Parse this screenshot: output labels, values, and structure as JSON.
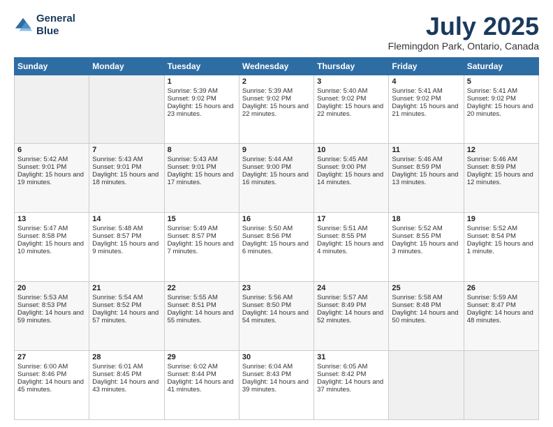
{
  "header": {
    "logo_line1": "General",
    "logo_line2": "Blue",
    "title": "July 2025",
    "subtitle": "Flemingdon Park, Ontario, Canada"
  },
  "weekdays": [
    "Sunday",
    "Monday",
    "Tuesday",
    "Wednesday",
    "Thursday",
    "Friday",
    "Saturday"
  ],
  "weeks": [
    [
      {
        "day": "",
        "empty": true
      },
      {
        "day": "",
        "empty": true
      },
      {
        "day": "1",
        "sunrise": "5:39 AM",
        "sunset": "9:02 PM",
        "daylight": "15 hours and 23 minutes."
      },
      {
        "day": "2",
        "sunrise": "5:39 AM",
        "sunset": "9:02 PM",
        "daylight": "15 hours and 22 minutes."
      },
      {
        "day": "3",
        "sunrise": "5:40 AM",
        "sunset": "9:02 PM",
        "daylight": "15 hours and 22 minutes."
      },
      {
        "day": "4",
        "sunrise": "5:41 AM",
        "sunset": "9:02 PM",
        "daylight": "15 hours and 21 minutes."
      },
      {
        "day": "5",
        "sunrise": "5:41 AM",
        "sunset": "9:02 PM",
        "daylight": "15 hours and 20 minutes."
      }
    ],
    [
      {
        "day": "6",
        "sunrise": "5:42 AM",
        "sunset": "9:01 PM",
        "daylight": "15 hours and 19 minutes."
      },
      {
        "day": "7",
        "sunrise": "5:43 AM",
        "sunset": "9:01 PM",
        "daylight": "15 hours and 18 minutes."
      },
      {
        "day": "8",
        "sunrise": "5:43 AM",
        "sunset": "9:01 PM",
        "daylight": "15 hours and 17 minutes."
      },
      {
        "day": "9",
        "sunrise": "5:44 AM",
        "sunset": "9:00 PM",
        "daylight": "15 hours and 16 minutes."
      },
      {
        "day": "10",
        "sunrise": "5:45 AM",
        "sunset": "9:00 PM",
        "daylight": "15 hours and 14 minutes."
      },
      {
        "day": "11",
        "sunrise": "5:46 AM",
        "sunset": "8:59 PM",
        "daylight": "15 hours and 13 minutes."
      },
      {
        "day": "12",
        "sunrise": "5:46 AM",
        "sunset": "8:59 PM",
        "daylight": "15 hours and 12 minutes."
      }
    ],
    [
      {
        "day": "13",
        "sunrise": "5:47 AM",
        "sunset": "8:58 PM",
        "daylight": "15 hours and 10 minutes."
      },
      {
        "day": "14",
        "sunrise": "5:48 AM",
        "sunset": "8:57 PM",
        "daylight": "15 hours and 9 minutes."
      },
      {
        "day": "15",
        "sunrise": "5:49 AM",
        "sunset": "8:57 PM",
        "daylight": "15 hours and 7 minutes."
      },
      {
        "day": "16",
        "sunrise": "5:50 AM",
        "sunset": "8:56 PM",
        "daylight": "15 hours and 6 minutes."
      },
      {
        "day": "17",
        "sunrise": "5:51 AM",
        "sunset": "8:55 PM",
        "daylight": "15 hours and 4 minutes."
      },
      {
        "day": "18",
        "sunrise": "5:52 AM",
        "sunset": "8:55 PM",
        "daylight": "15 hours and 3 minutes."
      },
      {
        "day": "19",
        "sunrise": "5:52 AM",
        "sunset": "8:54 PM",
        "daylight": "15 hours and 1 minute."
      }
    ],
    [
      {
        "day": "20",
        "sunrise": "5:53 AM",
        "sunset": "8:53 PM",
        "daylight": "14 hours and 59 minutes."
      },
      {
        "day": "21",
        "sunrise": "5:54 AM",
        "sunset": "8:52 PM",
        "daylight": "14 hours and 57 minutes."
      },
      {
        "day": "22",
        "sunrise": "5:55 AM",
        "sunset": "8:51 PM",
        "daylight": "14 hours and 55 minutes."
      },
      {
        "day": "23",
        "sunrise": "5:56 AM",
        "sunset": "8:50 PM",
        "daylight": "14 hours and 54 minutes."
      },
      {
        "day": "24",
        "sunrise": "5:57 AM",
        "sunset": "8:49 PM",
        "daylight": "14 hours and 52 minutes."
      },
      {
        "day": "25",
        "sunrise": "5:58 AM",
        "sunset": "8:48 PM",
        "daylight": "14 hours and 50 minutes."
      },
      {
        "day": "26",
        "sunrise": "5:59 AM",
        "sunset": "8:47 PM",
        "daylight": "14 hours and 48 minutes."
      }
    ],
    [
      {
        "day": "27",
        "sunrise": "6:00 AM",
        "sunset": "8:46 PM",
        "daylight": "14 hours and 45 minutes."
      },
      {
        "day": "28",
        "sunrise": "6:01 AM",
        "sunset": "8:45 PM",
        "daylight": "14 hours and 43 minutes."
      },
      {
        "day": "29",
        "sunrise": "6:02 AM",
        "sunset": "8:44 PM",
        "daylight": "14 hours and 41 minutes."
      },
      {
        "day": "30",
        "sunrise": "6:04 AM",
        "sunset": "8:43 PM",
        "daylight": "14 hours and 39 minutes."
      },
      {
        "day": "31",
        "sunrise": "6:05 AM",
        "sunset": "8:42 PM",
        "daylight": "14 hours and 37 minutes."
      },
      {
        "day": "",
        "empty": true
      },
      {
        "day": "",
        "empty": true
      }
    ]
  ]
}
